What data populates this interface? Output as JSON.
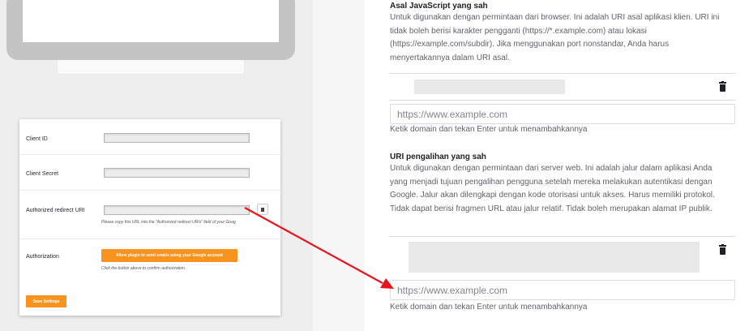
{
  "wp_settings": {
    "client_id_label": "Client ID",
    "client_secret_label": "Client Secret",
    "redirect_uri_label": "Authorized redirect URI",
    "redirect_uri_help": "Please copy this URL into the \"Authorized redirect URIs\" field of your Goog",
    "authorization_label": "Authorization",
    "allow_button_label": "Allow plugin to send emails using your Google account",
    "allow_help": "Click the button above to confirm authorization.",
    "save_button_label": "Save Settings",
    "copy_icon": "copy-icon"
  },
  "js_origins": {
    "title": "Asal JavaScript yang sah",
    "description": "Untuk digunakan dengan permintaan dari browser. Ini adalah URI asal aplikasi klien. URI ini tidak boleh berisi karakter pengganti (https://*.example.com) atau lokasi (https://example.com/subdir). Jika menggunakan port nonstandar, Anda harus menyertakannya dalam URI asal.",
    "input_placeholder": "https://www.example.com",
    "hint": "Ketik domain dan tekan Enter untuk menambahkannya",
    "delete_icon": "trash-icon"
  },
  "redirect_uris": {
    "title": "URI pengalihan yang sah",
    "description": "Untuk digunakan dengan permintaan dari server web. Ini adalah jalur dalam aplikasi Anda yang menjadi tujuan pengalihan pengguna setelah mereka melakukan autentikasi dengan Google. Jalur akan dilengkapi dengan kode otorisasi untuk akses. Harus memiliki protokol. Tidak dapat berisi fragmen URL atau jalur relatif. Tidak boleh merupakan alamat IP publik.",
    "input_placeholder": "https://www.example.com",
    "hint": "Ketik domain dan tekan Enter untuk menambahkannya",
    "delete_icon": "trash-icon"
  },
  "colors": {
    "accent_orange": "#f7931e",
    "arrow_red": "#e8141c"
  }
}
